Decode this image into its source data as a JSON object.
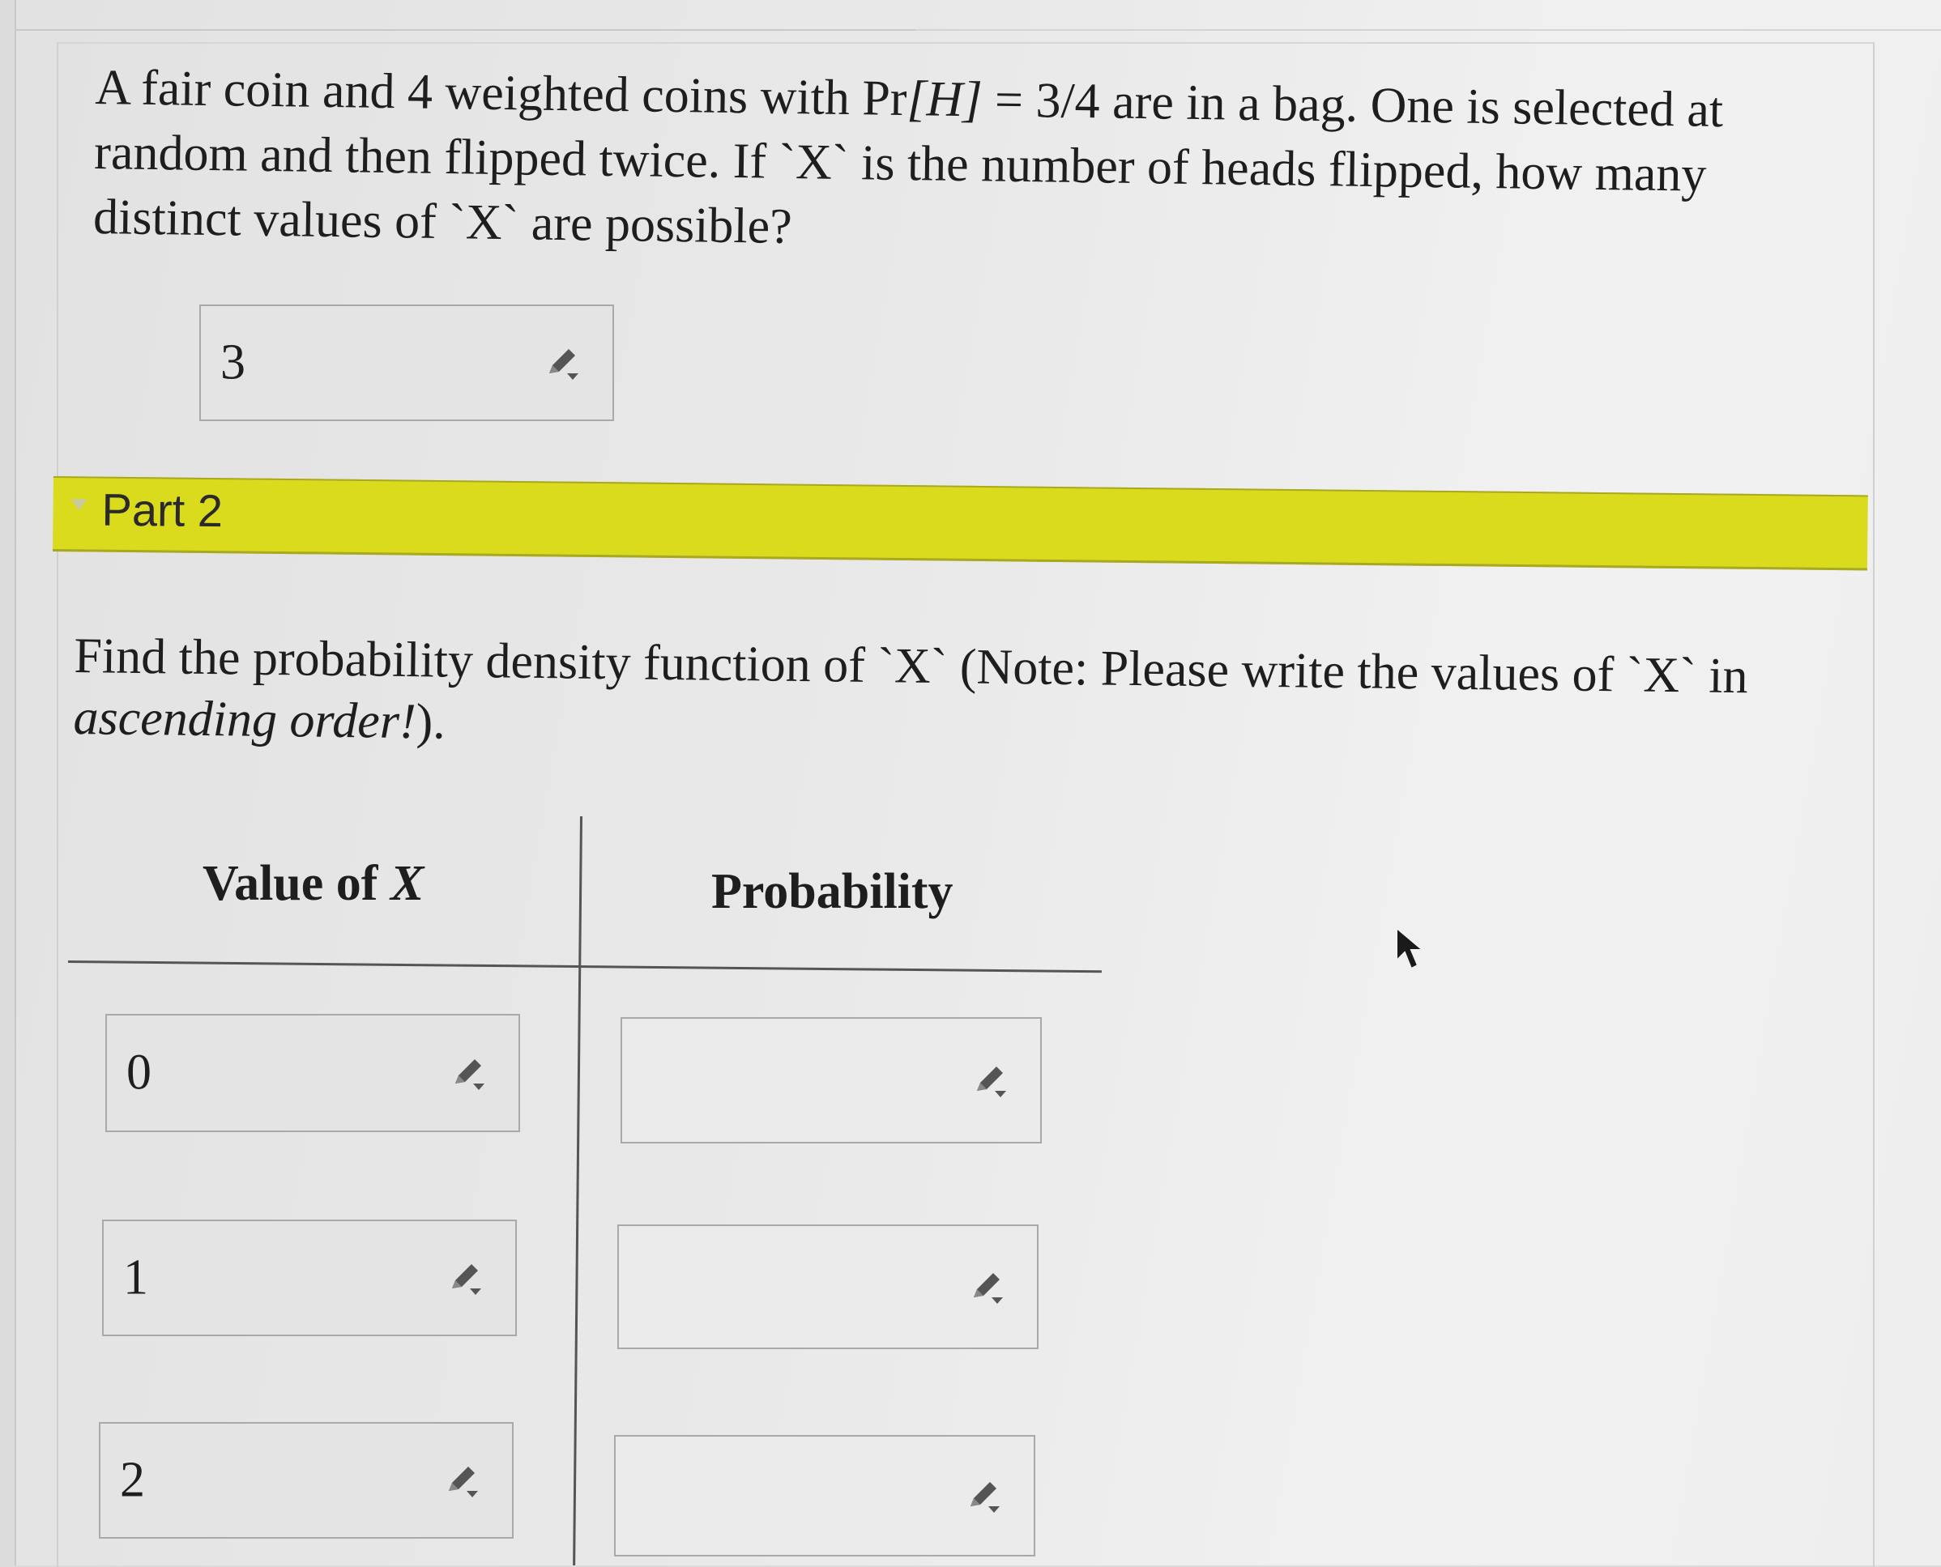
{
  "part1": {
    "question_prefix": "A fair coin and 4 weighted coins with Pr",
    "question_math": "[H]",
    "question_suffix": " = 3/4 are in a bag. One is selected at random and then flipped twice. If `X` is the number of heads flipped, how many distinct values of `X` are possible?",
    "answer": "3"
  },
  "part2": {
    "label": "Part 2",
    "question_prefix": "Find the probability density function of `X` (Note: Please write the values of `X` in ",
    "question_emphasis": "ascending order!",
    "question_suffix": ").",
    "table": {
      "col1_prefix": "Value of ",
      "col1_math": "X",
      "col2": "Probability",
      "rows": [
        {
          "value": "0",
          "probability": ""
        },
        {
          "value": "1",
          "probability": ""
        },
        {
          "value": "2",
          "probability": ""
        }
      ]
    }
  },
  "icons": {
    "edit": "pencil-icon",
    "pointer": "mouse-cursor-icon"
  },
  "colors": {
    "part_bar": "#dbdb1d",
    "pencil": "#555555"
  }
}
